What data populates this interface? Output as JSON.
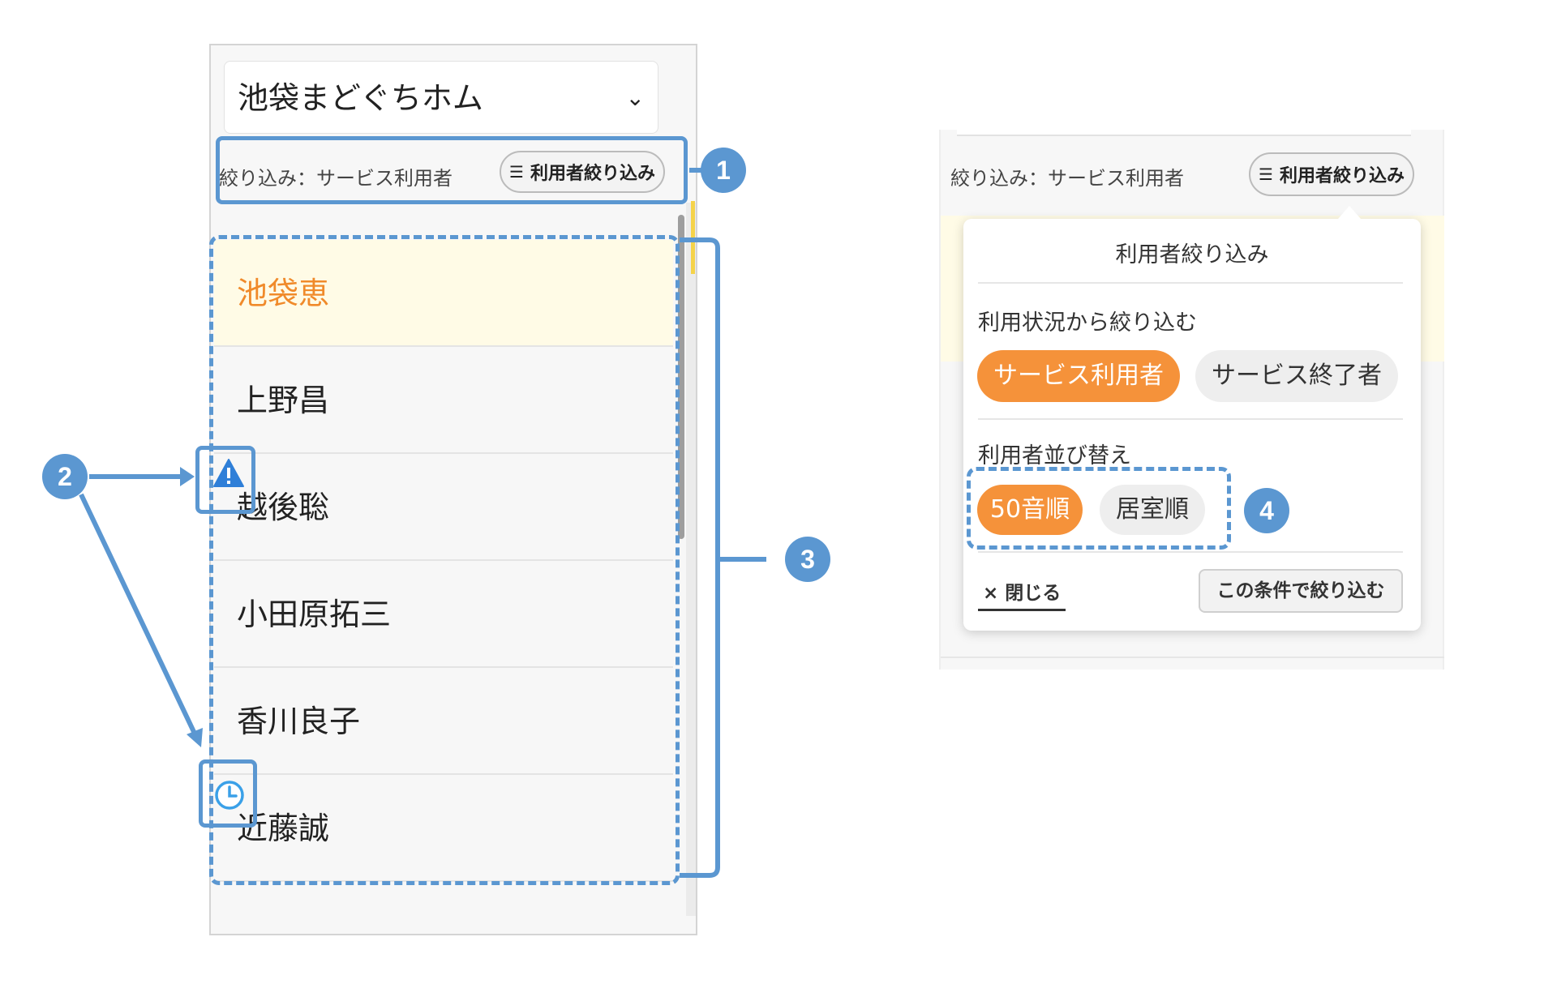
{
  "left": {
    "facility": "池袋まどぐちホム",
    "filter_label": "絞り込み：サービス利用者",
    "filter_button": "利用者絞り込み",
    "users": [
      "池袋恵",
      "上野昌",
      "越後聡",
      "小田原拓三",
      "香川良子",
      "近藤誠"
    ]
  },
  "callouts": {
    "c1": "1",
    "c2": "2",
    "c3": "3",
    "c4": "4"
  },
  "right": {
    "filter_label": "絞り込み：サービス利用者",
    "filter_button": "利用者絞り込み",
    "popover": {
      "title": "利用者絞り込み",
      "status_section": "利用状況から絞り込む",
      "status_options": [
        "サービス利用者",
        "サービス終了者"
      ],
      "status_selected": "サービス利用者",
      "sort_section": "利用者並び替え",
      "sort_options": [
        "50音順",
        "居室順"
      ],
      "sort_selected": "50音順",
      "close": "× 閉じる",
      "apply": "この条件で絞り込む"
    }
  },
  "colors": {
    "accent": "#f5923a",
    "active_name": "#f08a2a",
    "annotation": "#5b97d1",
    "warning_icon": "#2f7fd8",
    "clock_icon": "#3aa0e8"
  },
  "icons": {
    "filter": "sliders-icon",
    "dropdown": "chevron-down-icon",
    "warning": "warning-triangle-icon",
    "pending": "clock-icon"
  }
}
